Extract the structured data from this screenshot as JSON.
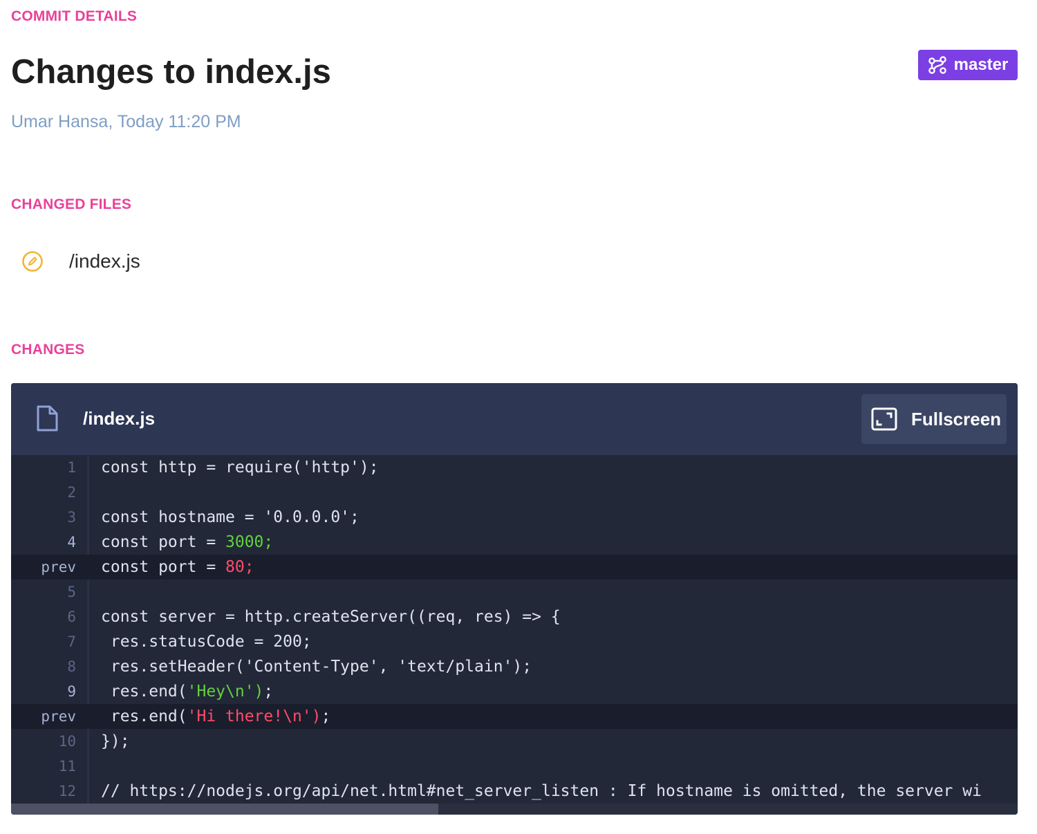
{
  "header": {
    "section_label": "COMMIT DETAILS",
    "title": "Changes to index.js",
    "meta": "Umar Hansa, Today 11:20 PM",
    "branch": {
      "label": "master",
      "icon": "branch-icon",
      "color": "#7b3fe4"
    }
  },
  "changed_files": {
    "section_label": "CHANGED FILES",
    "files": [
      {
        "name": "/index.js",
        "icon": "edit-icon",
        "icon_color": "#f2b535"
      }
    ]
  },
  "changes": {
    "section_label": "CHANGES",
    "file_name": "/index.js",
    "file_icon": "document-icon",
    "fullscreen_label": "Fullscreen",
    "fullscreen_icon": "fullscreen-icon",
    "colors": {
      "added": "#63d13e",
      "removed": "#ff4b6a",
      "accent": "#e8429a"
    },
    "lines": [
      {
        "num": "1",
        "type": "normal",
        "segments": [
          {
            "t": "const http = require('http');",
            "c": ""
          }
        ]
      },
      {
        "num": "2",
        "type": "normal",
        "segments": [
          {
            "t": "",
            "c": ""
          }
        ]
      },
      {
        "num": "3",
        "type": "normal",
        "segments": [
          {
            "t": "const hostname = '0.0.0.0';",
            "c": ""
          }
        ]
      },
      {
        "num": "4",
        "type": "changed",
        "segments": [
          {
            "t": "const port = ",
            "c": ""
          },
          {
            "t": "3000;",
            "c": "g"
          }
        ]
      },
      {
        "num": "prev",
        "type": "prev",
        "segments": [
          {
            "t": "const port = ",
            "c": ""
          },
          {
            "t": "80;",
            "c": "r"
          }
        ]
      },
      {
        "num": "5",
        "type": "normal",
        "segments": [
          {
            "t": "",
            "c": ""
          }
        ]
      },
      {
        "num": "6",
        "type": "normal",
        "segments": [
          {
            "t": "const server = http.createServer((req, res) => {",
            "c": ""
          }
        ]
      },
      {
        "num": "7",
        "type": "normal",
        "segments": [
          {
            "t": " res.statusCode = 200;",
            "c": ""
          }
        ]
      },
      {
        "num": "8",
        "type": "normal",
        "segments": [
          {
            "t": " res.setHeader('Content-Type', 'text/plain');",
            "c": ""
          }
        ]
      },
      {
        "num": "9",
        "type": "changed",
        "segments": [
          {
            "t": " res.end(",
            "c": ""
          },
          {
            "t": "'Hey\\n')",
            "c": "g"
          },
          {
            "t": ";",
            "c": ""
          }
        ]
      },
      {
        "num": "prev",
        "type": "prev",
        "segments": [
          {
            "t": " res.end(",
            "c": ""
          },
          {
            "t": "'Hi there!\\n')",
            "c": "r"
          },
          {
            "t": ";",
            "c": ""
          }
        ]
      },
      {
        "num": "10",
        "type": "normal",
        "segments": [
          {
            "t": "});",
            "c": ""
          }
        ]
      },
      {
        "num": "11",
        "type": "normal",
        "segments": [
          {
            "t": "",
            "c": ""
          }
        ]
      },
      {
        "num": "12",
        "type": "normal",
        "segments": [
          {
            "t": "// https://nodejs.org/api/net.html#net_server_listen : If hostname is omitted, the server wi",
            "c": ""
          }
        ]
      }
    ]
  }
}
